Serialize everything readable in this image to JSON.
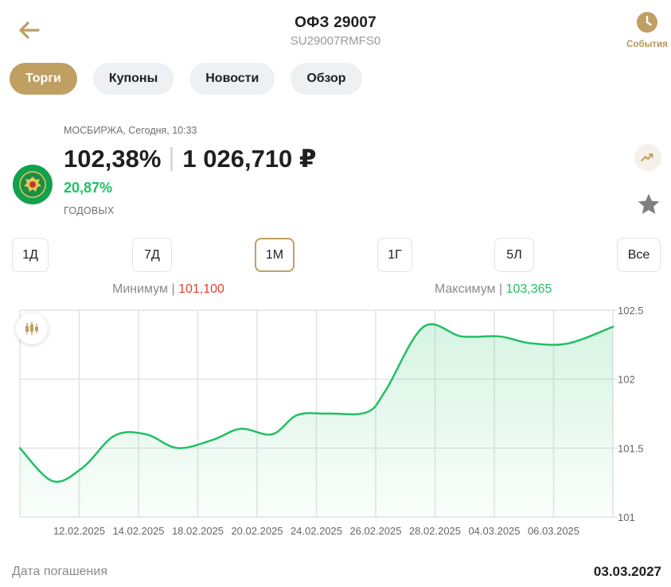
{
  "header": {
    "title": "ОФЗ 29007",
    "isin": "SU29007RMFS0",
    "events_label": "События"
  },
  "tabs": [
    {
      "label": "Торги",
      "active": true
    },
    {
      "label": "Купоны",
      "active": false
    },
    {
      "label": "Новости",
      "active": false
    },
    {
      "label": "Обзор",
      "active": false
    }
  ],
  "quote": {
    "exchange_line": "МОСБИРЖА, Сегодня, 10:33",
    "price_percent": "102,38%",
    "price_rub": "1 026,710 ₽",
    "yield": "20,87%",
    "yield_label": "ГОДОВЫХ"
  },
  "periods": [
    {
      "label": "1Д",
      "active": false
    },
    {
      "label": "7Д",
      "active": false
    },
    {
      "label": "1М",
      "active": true
    },
    {
      "label": "1Г",
      "active": false
    },
    {
      "label": "5Л",
      "active": false
    },
    {
      "label": "Все",
      "active": false
    }
  ],
  "minmax": {
    "min_label": "Минимум",
    "min_value": "101,100",
    "max_label": "Максимум",
    "max_value": "103,365"
  },
  "colors": {
    "accent": "#bf9f62",
    "line": "#21c063",
    "min": "#e8412f",
    "max": "#21c063"
  },
  "chart_data": {
    "type": "area",
    "ylim": [
      101,
      102.5
    ],
    "y_ticks": [
      "102.5",
      "102",
      "101.5",
      "101"
    ],
    "x_tick_labels": [
      "12.02.2025",
      "14.02.2025",
      "18.02.2025",
      "20.02.2025",
      "24.02.2025",
      "26.02.2025",
      "28.02.2025",
      "04.03.2025",
      "06.03.2025"
    ],
    "grid": true,
    "series": [
      {
        "points": [
          [
            0,
            101.5
          ],
          [
            2.6,
            101.26
          ],
          [
            5,
            101.36
          ],
          [
            7.5,
            101.59
          ],
          [
            10,
            101.6
          ],
          [
            12.5,
            101.5
          ],
          [
            15.3,
            101.56
          ],
          [
            17.5,
            101.64
          ],
          [
            20,
            101.6
          ],
          [
            22,
            101.74
          ],
          [
            24.5,
            101.75
          ],
          [
            27.5,
            101.76
          ],
          [
            29,
            101.92
          ],
          [
            32,
            102.38
          ],
          [
            35,
            102.31
          ],
          [
            38,
            102.31
          ],
          [
            40.5,
            102.26
          ],
          [
            43.5,
            102.26
          ],
          [
            47,
            102.38
          ]
        ]
      }
    ]
  },
  "maturity": {
    "label": "Дата погашения",
    "value": "03.03.2027"
  }
}
